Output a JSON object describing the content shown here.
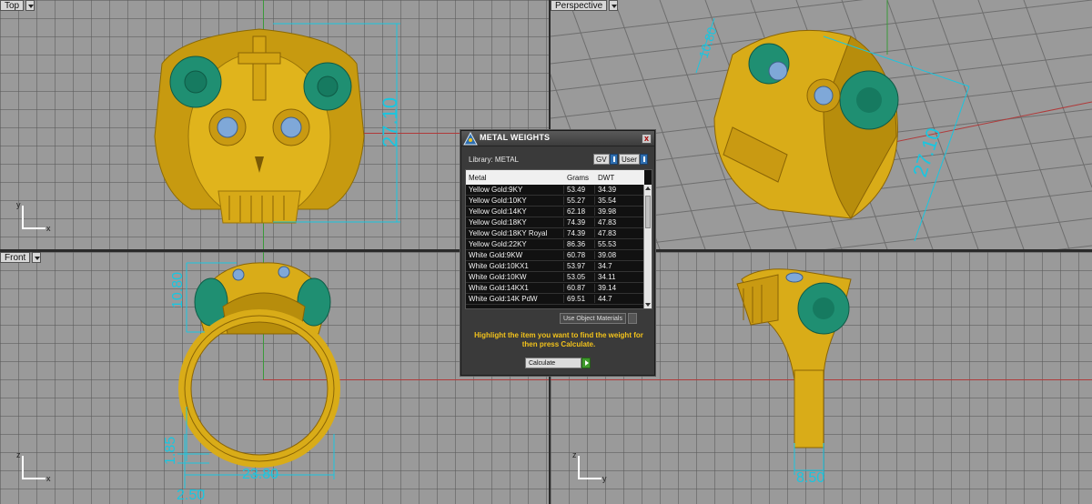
{
  "viewports": {
    "top": {
      "label": "Top",
      "axis_y": "y",
      "axis_x": "x"
    },
    "perspective": {
      "label": "Perspective"
    },
    "front": {
      "label": "Front",
      "axis_y": "z",
      "axis_x": "x"
    },
    "right": {
      "axis_y": "z",
      "axis_x": "y"
    }
  },
  "dimensions": {
    "top_height": "27.10",
    "persp_height": "10.80",
    "persp_length": "27.10",
    "front_top_height": "10.80",
    "front_width": "23.80",
    "front_band": "1.85",
    "front_bottom": "2.50",
    "side_width": "8.50"
  },
  "dialog": {
    "title": "METAL WEIGHTS",
    "close": "x",
    "library_label": "Library: METAL",
    "toggle_gv": "GV",
    "toggle_user": "User",
    "columns": [
      "Metal",
      "Grams",
      "DWT"
    ],
    "rows": [
      [
        "Yellow Gold:9KY",
        "53.49",
        "34.39"
      ],
      [
        "Yellow Gold:10KY",
        "55.27",
        "35.54"
      ],
      [
        "Yellow Gold:14KY",
        "62.18",
        "39.98"
      ],
      [
        "Yellow Gold:18KY",
        "74.39",
        "47.83"
      ],
      [
        "Yellow Gold:18KY Royal",
        "74.39",
        "47.83"
      ],
      [
        "Yellow Gold:22KY",
        "86.36",
        "55.53"
      ],
      [
        "White Gold:9KW",
        "60.78",
        "39.08"
      ],
      [
        "White Gold:10KX1",
        "53.97",
        "34.7"
      ],
      [
        "White Gold:10KW",
        "53.05",
        "34.11"
      ],
      [
        "White Gold:14KX1",
        "60.87",
        "39.14"
      ],
      [
        "White Gold:14K PdW",
        "69.51",
        "44.7"
      ]
    ],
    "use_object_materials": "Use Object Materials",
    "hint": "Highlight the item you want to find the weight for then press Calculate.",
    "calculate": "Calculate"
  },
  "colors": {
    "dimension": "#19c6e0",
    "gold": "#d9b21a",
    "enamel": "#1f8f72",
    "gem": "#7fa8d8"
  }
}
